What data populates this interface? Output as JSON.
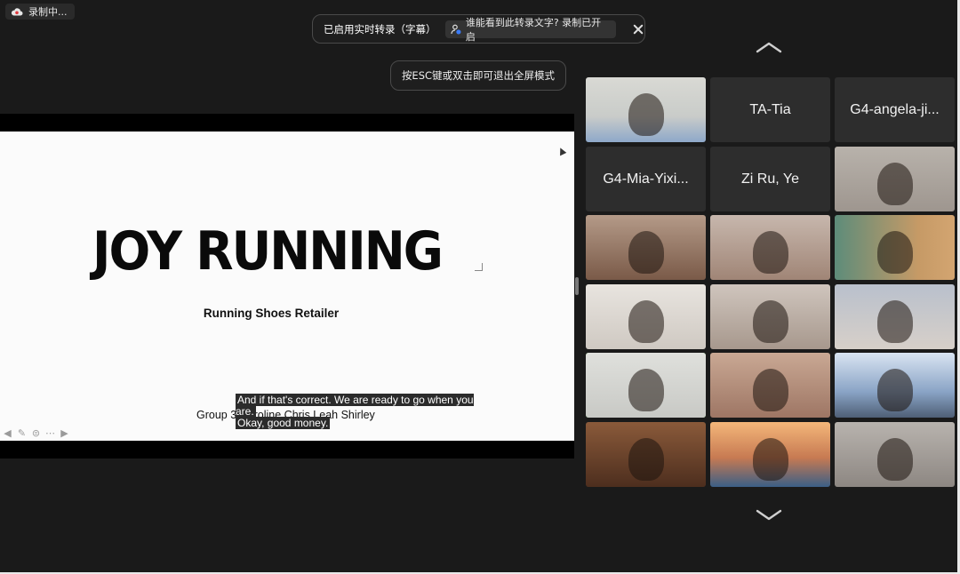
{
  "recording": {
    "label": "录制中..."
  },
  "transcript_bar": {
    "text": "已启用实时转录（字幕）",
    "who_can_see": "谁能看到此转录文字? 录制已开启"
  },
  "fullscreen_hint": "按ESC键或双击即可退出全屏模式",
  "slide": {
    "title": "JOY RUNNING",
    "subtitle": "Running Shoes Retailer",
    "group_text": "Group 3  Caroline Chris Leah Shirley"
  },
  "caption": {
    "line1": "And if that's correct. We are ready to go when you are.",
    "line2": "Okay, good money."
  },
  "participants": [
    {
      "type": "video",
      "label": ""
    },
    {
      "type": "name",
      "label": "TA-Tia"
    },
    {
      "type": "name",
      "label": "G4-angela-ji..."
    },
    {
      "type": "name",
      "label": "G4-Mia-Yixi..."
    },
    {
      "type": "name",
      "label": "Zi Ru, Ye"
    },
    {
      "type": "video",
      "label": ""
    },
    {
      "type": "video",
      "label": ""
    },
    {
      "type": "video",
      "label": ""
    },
    {
      "type": "video",
      "label": ""
    },
    {
      "type": "video",
      "label": ""
    },
    {
      "type": "video",
      "label": ""
    },
    {
      "type": "video",
      "label": ""
    },
    {
      "type": "video",
      "label": "",
      "active": true
    },
    {
      "type": "video",
      "label": ""
    },
    {
      "type": "video",
      "label": ""
    },
    {
      "type": "video",
      "label": ""
    },
    {
      "type": "video",
      "label": ""
    },
    {
      "type": "video",
      "label": ""
    }
  ],
  "colors": {
    "active_speaker": "#5ad03c",
    "background": "#1a1a1a",
    "tile": "#2d2d2d"
  }
}
